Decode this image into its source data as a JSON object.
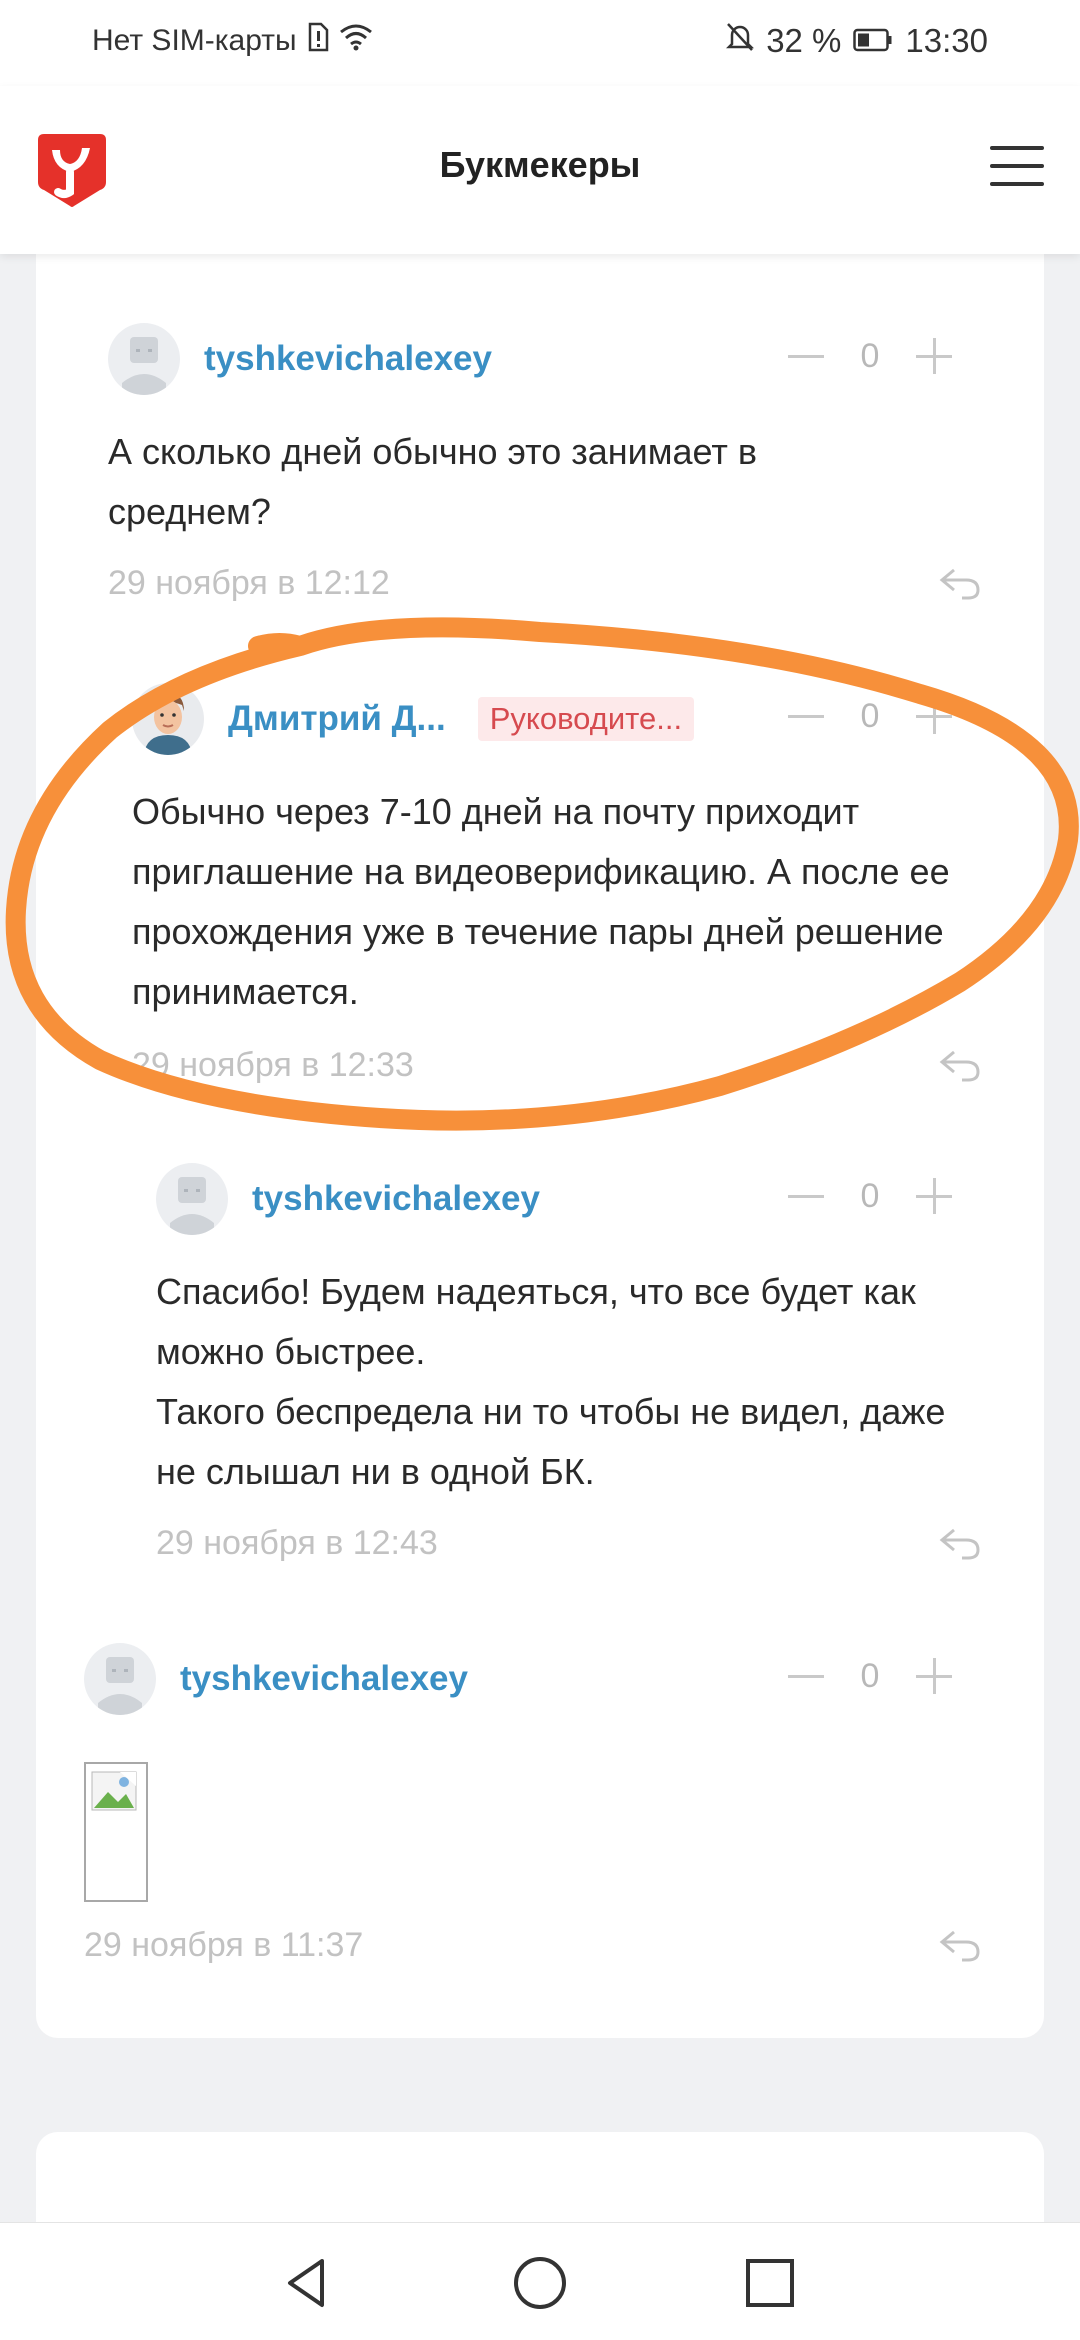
{
  "status_bar": {
    "carrier": "Нет SIM-карты",
    "battery": "32 %",
    "time": "13:30"
  },
  "header": {
    "title": "Букмекеры",
    "logo_icon": "logo-icon",
    "menu_icon": "hamburger-menu-icon"
  },
  "comments": [
    {
      "author": "tyshkevichalexey",
      "votes": "0",
      "text": "А сколько дней обычно это занимает в среднем?",
      "date": "29 ноября в 12:12"
    },
    {
      "author": "Дмитрий Д...",
      "badge": "Руководите...",
      "votes": "0",
      "text": "Обычно через 7-10 дней на почту приходит приглашение на видеоверификацию. А после ее прохождения уже в течение пары дней решение принимается.",
      "date": "29 ноября в 12:33"
    },
    {
      "author": "tyshkevichalexey",
      "votes": "0",
      "text_lines": [
        "Спасибо! Будем надеяться, что все будет как можно быстрее.",
        "Такого беспредела ни то чтобы не видел, даже не слышал ни в одной БК."
      ],
      "date": "29 ноября в 12:43"
    },
    {
      "author": "tyshkevichalexey",
      "votes": "0",
      "date": "29 ноября в 11:37"
    }
  ],
  "colors": {
    "author": "#3a8fc4",
    "badge_text": "#d64a4f",
    "badge_bg": "#fde9ea",
    "annotation": "#f7903a",
    "logo": "#e5312a"
  }
}
